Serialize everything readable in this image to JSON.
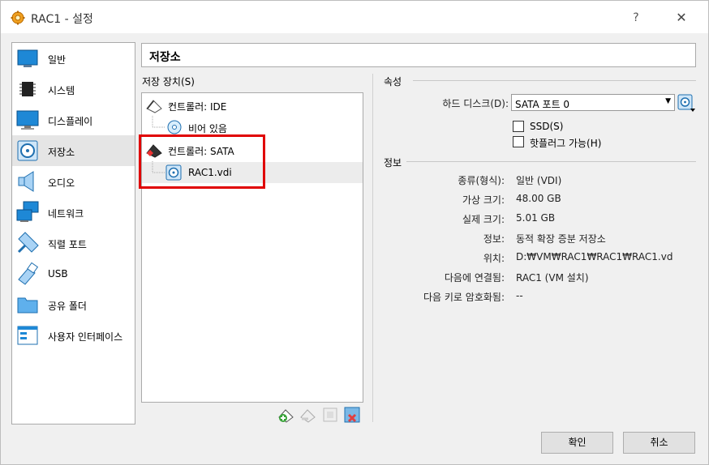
{
  "window": {
    "title": "RAC1 - 설정",
    "help": "?",
    "close": "✕"
  },
  "sidebar": {
    "items": [
      {
        "label": "일반",
        "icon": "general-icon"
      },
      {
        "label": "시스템",
        "icon": "system-chip-icon"
      },
      {
        "label": "디스플레이",
        "icon": "display-monitor-icon"
      },
      {
        "label": "저장소",
        "icon": "storage-disk-icon",
        "selected": true
      },
      {
        "label": "오디오",
        "icon": "speaker-icon"
      },
      {
        "label": "네트워크",
        "icon": "network-icon"
      },
      {
        "label": "직렬 포트",
        "icon": "serial-port-icon"
      },
      {
        "label": "USB",
        "icon": "usb-icon"
      },
      {
        "label": "공유 폴더",
        "icon": "shared-folder-icon"
      },
      {
        "label": "사용자 인터페이스",
        "icon": "user-interface-icon"
      }
    ]
  },
  "page": {
    "title": "저장소"
  },
  "storage": {
    "group_label": "저장 장치(S)",
    "tree": [
      {
        "label": "컨트롤러: IDE",
        "type": "controller"
      },
      {
        "label": "비어 있음",
        "type": "optical"
      },
      {
        "label": "컨트롤러: SATA",
        "type": "controller"
      },
      {
        "label": "RAC1.vdi",
        "type": "disk",
        "selected": true
      }
    ],
    "toolbar": [
      "add-controller-icon",
      "remove-controller-icon",
      "add-attachment-icon",
      "remove-attachment-icon"
    ]
  },
  "attributes": {
    "group_label": "속성",
    "hard_disk_label": "하드 디스크(D):",
    "hard_disk_value": "SATA 포트 0",
    "ssd_label": "SSD(S)",
    "ssd_checked": false,
    "hotplug_label": "핫플러그 가능(H)",
    "hotplug_checked": false
  },
  "info": {
    "group_label": "정보",
    "rows": [
      {
        "key": "종류(형식):",
        "value": "일반 (VDI)"
      },
      {
        "key": "가상 크기:",
        "value": "48.00 GB"
      },
      {
        "key": "실제 크기:",
        "value": "5.01 GB"
      },
      {
        "key": "정보:",
        "value": "동적 확장 증분 저장소"
      },
      {
        "key": "위치:",
        "value": "D:₩VM₩RAC1₩RAC1₩RAC1.vd"
      },
      {
        "key": "다음에 연결됨:",
        "value": "RAC1 (VM 설치)"
      },
      {
        "key": "다음 키로 암호화됨:",
        "value": "--"
      }
    ]
  },
  "buttons": {
    "ok": "확인",
    "cancel": "취소"
  },
  "colors": {
    "highlight_border": "#e00000",
    "accent_blue": "#1e88d6"
  }
}
